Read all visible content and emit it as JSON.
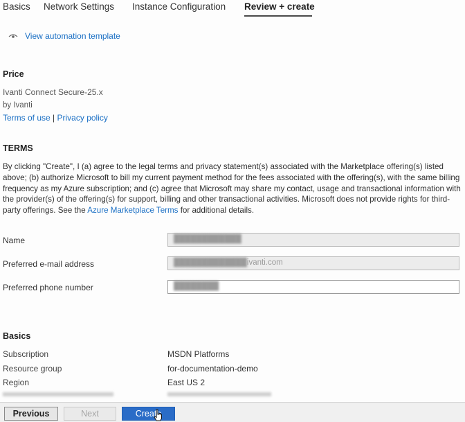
{
  "tabs": [
    {
      "label": "Basics"
    },
    {
      "label": "Network Settings"
    },
    {
      "label": "Instance Configuration"
    },
    {
      "label": "Review + create"
    }
  ],
  "active_tab": "Review + create",
  "automation_link": "View automation template",
  "price": {
    "heading": "Price",
    "product": "Ivanti Connect Secure-25.x",
    "publisher": "by Ivanti",
    "terms_link": "Terms of use",
    "separator": "|",
    "privacy_link": "Privacy policy"
  },
  "terms": {
    "heading": "TERMS",
    "body_part1": "By clicking \"Create\", I (a) agree to the legal terms and privacy statement(s) associated with the Marketplace offering(s) listed above; (b) authorize Microsoft to bill my current payment method for the fees associated with the offering(s), with the same billing frequency as my Azure subscription; and (c) agree that Microsoft may share my contact, usage and transactional information with the provider(s) of the offering(s) for support, billing and other transactional activities. Microsoft does not provide rights for third-party offerings. See the ",
    "link": "Azure Marketplace Terms",
    "body_part2": " for additional details."
  },
  "contact": {
    "name_label": "Name",
    "name_value": "████████████",
    "email_label": "Preferred e-mail address",
    "email_value_hidden": "█████████████",
    "email_domain": "ivanti.com",
    "phone_label": "Preferred phone number",
    "phone_value": "████████"
  },
  "basics": {
    "heading": "Basics",
    "rows": [
      {
        "key": "Subscription",
        "value": "MSDN Platforms"
      },
      {
        "key": "Resource group",
        "value": "for-documentation-demo"
      },
      {
        "key": "Region",
        "value": "East US 2"
      }
    ]
  },
  "footer": {
    "previous": "Previous",
    "next": "Next",
    "create": "Create"
  }
}
